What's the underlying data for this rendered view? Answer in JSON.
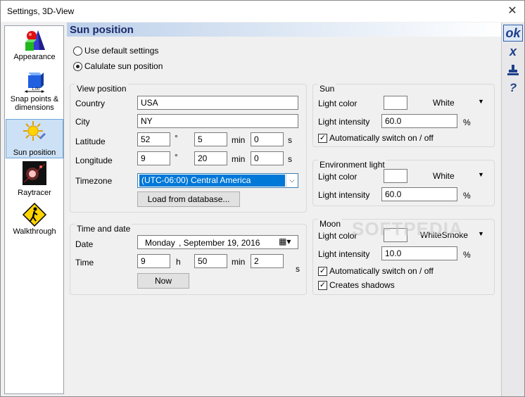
{
  "window": {
    "title": "Settings, 3D-View"
  },
  "sidebar": {
    "items": [
      {
        "label": "Appearance",
        "icon": "shapes-icon"
      },
      {
        "label_line1": "Snap points &",
        "label_line2": "dimensions",
        "icon": "cube-ruler-icon"
      },
      {
        "label": "Sun position",
        "icon": "sun-icon",
        "selected": true
      },
      {
        "label": "Raytracer",
        "icon": "light-flare-icon"
      },
      {
        "label": "Walkthrough",
        "icon": "walking-sign-icon"
      }
    ]
  },
  "toolbar": {
    "ok_label": "ok",
    "cancel_label": "x",
    "save_icon": "stamp-icon",
    "help_label": "?"
  },
  "page": {
    "title": "Sun position"
  },
  "mode": {
    "default_label": "Use default settings",
    "calc_label": "Calulate sun position",
    "selected": "calc"
  },
  "view_position": {
    "title": "View position",
    "country_label": "Country",
    "country": "USA",
    "city_label": "City",
    "city": "NY",
    "latitude_label": "Latitude",
    "lat_deg": "52",
    "lat_min": "5",
    "lat_sec": "0",
    "longitude_label": "Longitude",
    "lon_deg": "9",
    "lon_min": "20",
    "lon_sec": "0",
    "deg_unit": "°",
    "min_unit": "min",
    "sec_unit": "s",
    "timezone_label": "Timezone",
    "timezone": "(UTC-06:00) Central America",
    "load_button": "Load from database..."
  },
  "time_date": {
    "title": "Time and date",
    "date_label": "Date",
    "date_day": "Monday",
    "date_rest": ", September 19, 2016",
    "time_label": "Time",
    "hour": "9",
    "hour_unit": "h",
    "minute": "50",
    "min_unit": "min",
    "second": "2",
    "sec_unit": "s",
    "now_button": "Now"
  },
  "sun": {
    "title": "Sun",
    "color_label": "Light color",
    "color_name": "White",
    "color_hex": "#ffffff",
    "intensity_label": "Light intensity",
    "intensity": "60.0",
    "pct": "%",
    "auto_switch_label": "Automatically switch on / off",
    "auto_switch": true
  },
  "environment": {
    "title": "Environment light",
    "color_label": "Light color",
    "color_name": "White",
    "color_hex": "#ffffff",
    "intensity_label": "Light intensity",
    "intensity": "60.0",
    "pct": "%"
  },
  "moon": {
    "title": "Moon",
    "color_label": "Light color",
    "color_name": "WhiteSmoke",
    "color_hex": "#f5f5f5",
    "intensity_label": "Light intensity",
    "intensity": "10.0",
    "pct": "%",
    "auto_switch_label": "Automatically switch on / off",
    "auto_switch": true,
    "shadows_label": "Creates shadows",
    "shadows": true
  },
  "watermark": "SOFTPEDIA"
}
